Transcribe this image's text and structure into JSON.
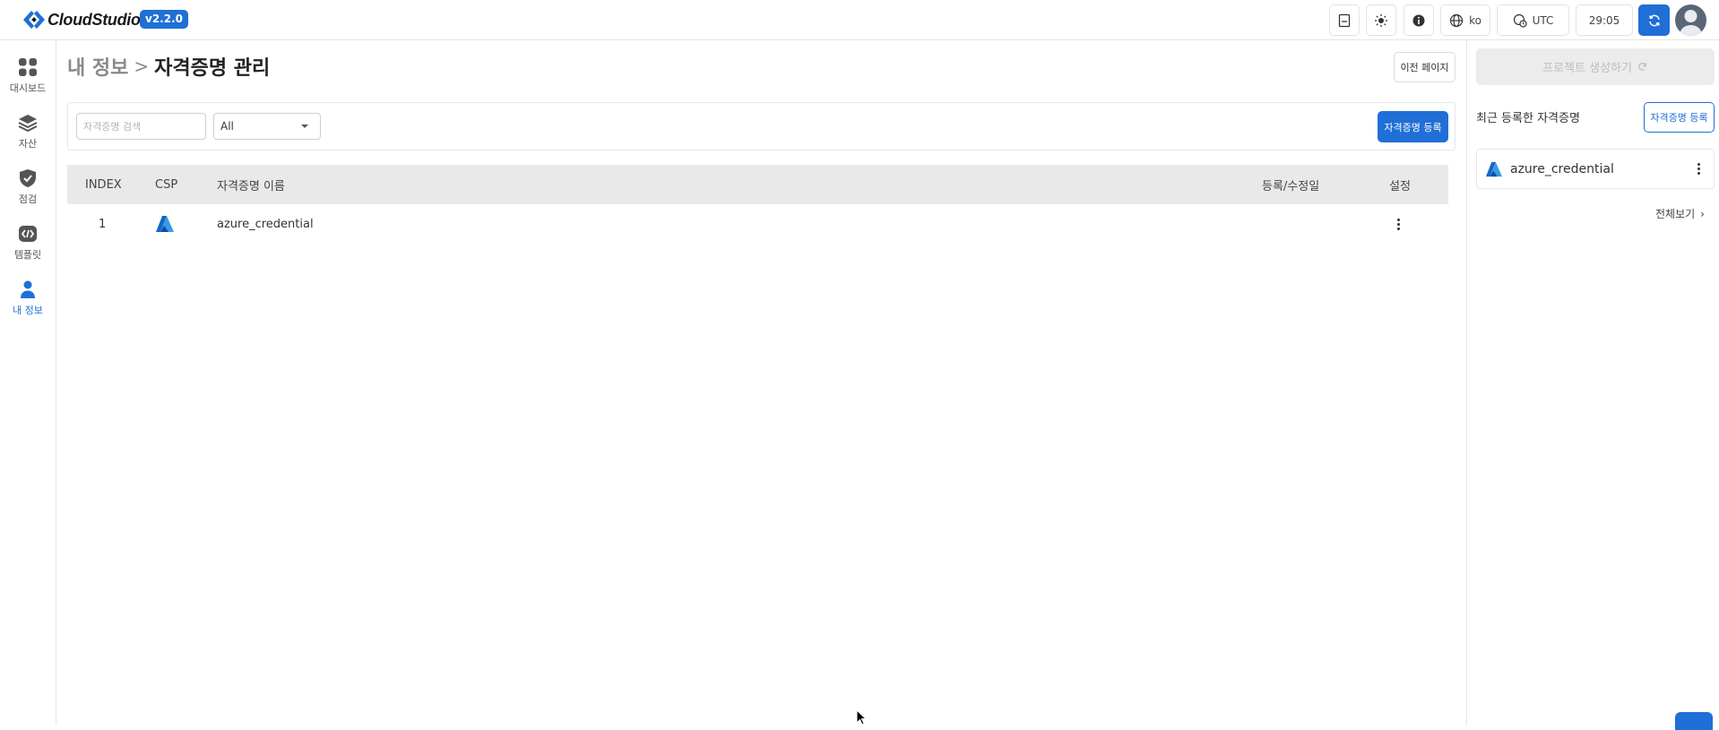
{
  "app": {
    "name": "CloudStudio",
    "version": "v2.2.0"
  },
  "topbar": {
    "language": "ko",
    "timezone": "UTC",
    "timer": "29:05",
    "icons": [
      "sidebar-toggle-icon",
      "sun-icon",
      "info-icon",
      "globe-icon",
      "clock-globe-icon",
      "refresh-icon",
      "user-avatar"
    ]
  },
  "sidebar": {
    "items": [
      {
        "label": "대시보드",
        "icon": "dashboard-icon"
      },
      {
        "label": "자산",
        "icon": "layers-icon"
      },
      {
        "label": "점검",
        "icon": "shield-check-icon"
      },
      {
        "label": "템플릿",
        "icon": "code-icon"
      },
      {
        "label": "내 정보",
        "icon": "person-icon",
        "active": true
      }
    ]
  },
  "breadcrumb": {
    "parent": "내 정보",
    "separator": ">",
    "current": "자격증명 관리"
  },
  "prev_page_label": "이전 페이지",
  "filter": {
    "search_placeholder": "자격증명 검색",
    "select_value": "All",
    "register_label": "자격증명 등록"
  },
  "table": {
    "headers": {
      "index": "INDEX",
      "csp": "CSP",
      "name": "자격증명 이름",
      "date": "등록/수정일",
      "settings": "설정"
    },
    "rows": [
      {
        "index": "1",
        "csp": "azure",
        "name": "azure_credential",
        "date": ""
      }
    ]
  },
  "right_panel": {
    "create_project_label": "프로젝트 생성하기",
    "recent_title": "최근 등록한 자격증명",
    "register_label": "자격증명 등록",
    "recent_items": [
      {
        "name": "azure_credential",
        "csp": "azure"
      }
    ],
    "view_all_label": "전체보기"
  },
  "colors": {
    "primary": "#1f6fd6",
    "table_header_bg": "#e9e9e9",
    "border": "#e6e6e6"
  }
}
